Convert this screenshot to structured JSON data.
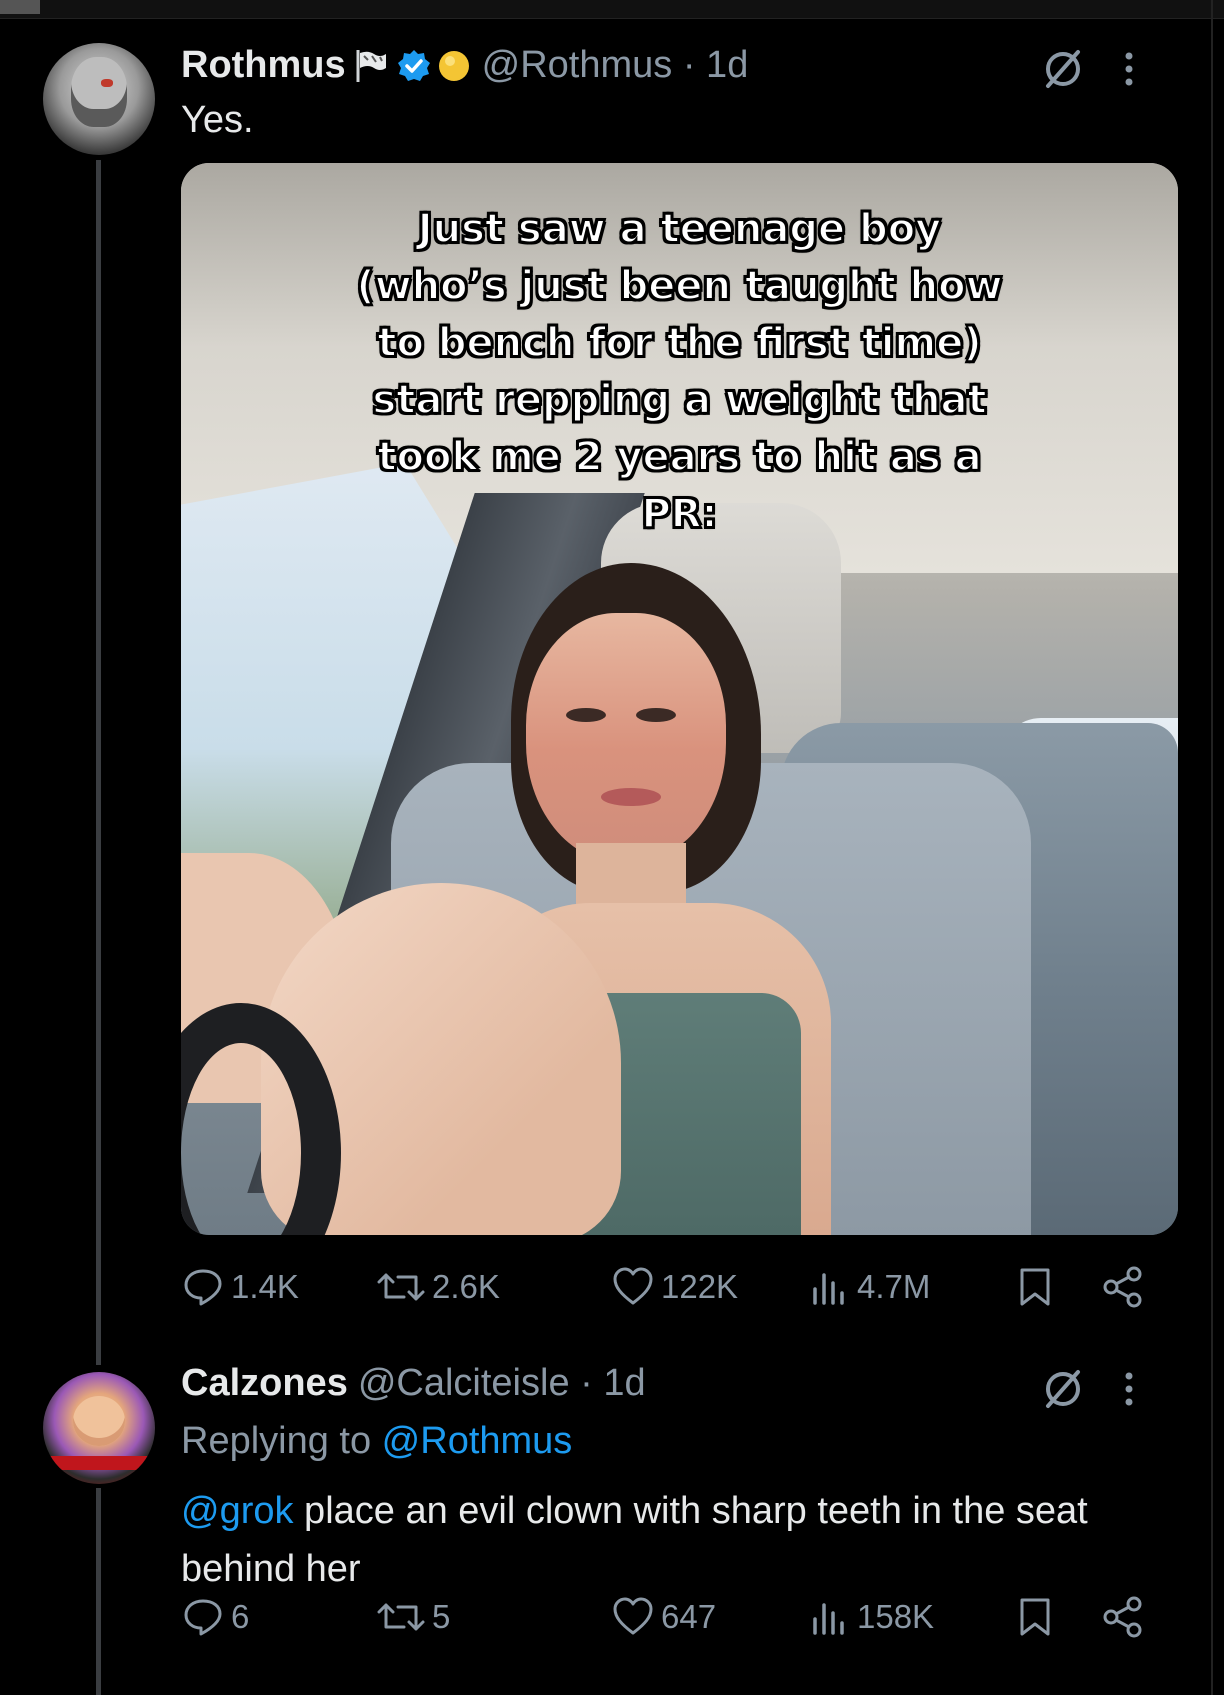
{
  "tweets": [
    {
      "display_name": "Rothmus",
      "handle_meta": "@Rothmus · 1d",
      "text": "Yes.",
      "media": {
        "caption": "Just saw a teenage boy\n(who’s just been taught how\nto bench for the first time)\nstart repping a weight that\ntook me 2 years to hit as a\nPR:"
      },
      "stats": {
        "replies": "1.4K",
        "retweets": "2.6K",
        "likes": "122K",
        "views": "4.7M"
      }
    },
    {
      "display_name": "Calzones",
      "handle_meta": "@Calciteisle · 1d",
      "replying_prefix": "Replying to ",
      "replying_to": "@Rothmus",
      "mention": "@grok",
      "text": " place an evil clown with sharp teeth in the seat behind her",
      "stats": {
        "replies": "6",
        "retweets": "5",
        "likes": "647",
        "views": "158K"
      }
    }
  ],
  "icons": {
    "flag": "flag-icon",
    "verified": "verified-badge-icon",
    "gold": "gold-circle-icon",
    "grok": "grok-slash-icon",
    "more": "more-vertical-icon",
    "reply": "reply-icon",
    "retweet": "retweet-icon",
    "like": "heart-icon",
    "views": "views-icon",
    "bookmark": "bookmark-icon",
    "share": "share-icon"
  },
  "colors": {
    "background": "#000000",
    "text_primary": "#e7e9ea",
    "text_secondary": "#8b98a5",
    "accent": "#1d9bf0",
    "gold": "#f4c534",
    "thread_line": "#3a3d41"
  }
}
